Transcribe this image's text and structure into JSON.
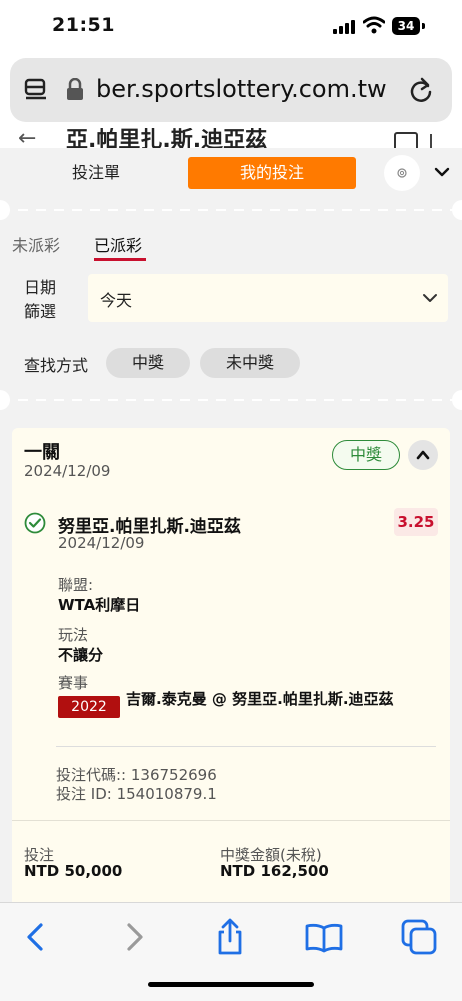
{
  "status_bar": {
    "time": "21:51",
    "battery": "34"
  },
  "browser": {
    "url": "ber.sportslottery.com.tw"
  },
  "background_page": {
    "title": "亞.帕里扎.斯.迪亞茲"
  },
  "slip": {
    "tab_bet_slip": "投注單",
    "tab_my_bets": "我的投注",
    "subtab_unsettled": "未派彩",
    "subtab_settled": "已派彩",
    "date_filter_label": "日期篩選",
    "date_filter_value": "今天",
    "search_label": "查找方式",
    "chip_won": "中獎",
    "chip_lost": "未中獎"
  },
  "bet": {
    "type": "一關",
    "date": "2024/12/09",
    "result": "中獎",
    "selection": "努里亞.帕里扎斯.迪亞茲",
    "odds": "3.25",
    "selection_date": "2024/12/09",
    "league_label": "聯盟:",
    "league_value": "WTA利摩日",
    "market_label": "玩法",
    "market_value": "不讓分",
    "event_label": "賽事",
    "event_year": "2022",
    "event_name": "吉爾.泰克曼 @ 努里亞.帕里扎斯.迪亞茲",
    "bet_code": "投注代碼:: 136752696",
    "bet_id": "投注 ID: 154010879.1",
    "stake_label": "投注",
    "stake_value": "NTD 50,000",
    "payout_label": "中獎金額(未稅)",
    "payout_value": "NTD 162,500"
  },
  "colors": {
    "accent_orange": "#ff7a00",
    "win_green": "#2e8b3a",
    "odds_red": "#c8102e",
    "ios_blue": "#1f6fe5"
  },
  "toolbar_icons": [
    "back-icon",
    "forward-icon",
    "share-icon",
    "bookmarks-icon",
    "tabs-icon"
  ]
}
